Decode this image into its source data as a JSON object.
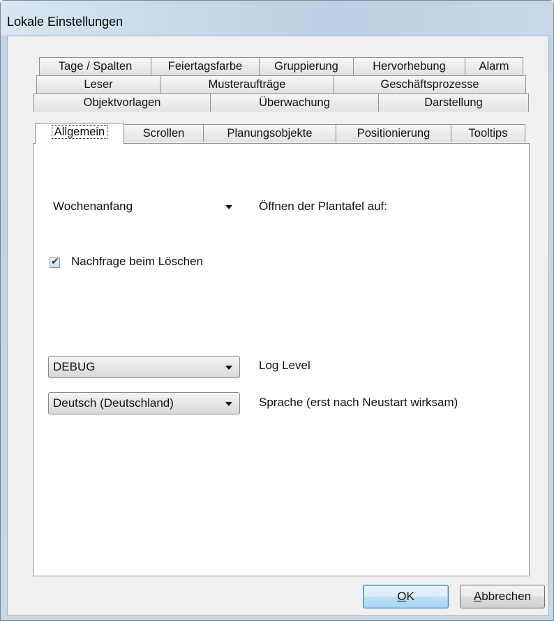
{
  "window": {
    "title": "Lokale Einstellungen"
  },
  "tabs": {
    "row1": [
      "Tage / Spalten",
      "Feiertagsfarbe",
      "Gruppierung",
      "Hervorhebung",
      "Alarm"
    ],
    "row2": [
      "Leser",
      "Musteraufträge",
      "Geschäftsprozesse"
    ],
    "row3": [
      "Objektvorlagen",
      "Überwachung",
      "Darstellung"
    ],
    "row4": [
      "Allgemein",
      "Scrollen",
      "Planungsobjekte",
      "Positionierung",
      "Tooltips"
    ],
    "active": "Allgemein"
  },
  "general": {
    "week_start": {
      "value": "Wochenanfang",
      "label": "Öffnen der Plantafel auf:"
    },
    "confirm_delete": {
      "label": "Nachfrage beim Löschen",
      "checked": true
    },
    "log_level": {
      "value": "DEBUG",
      "label": "Log Level"
    },
    "language": {
      "value": "Deutsch (Deutschland)",
      "label": "Sprache (erst nach Neustart wirksam)"
    }
  },
  "buttons": {
    "ok": {
      "mnemonic": "O",
      "rest": "K"
    },
    "cancel": {
      "mnemonic": "A",
      "rest": "bbrechen"
    }
  }
}
